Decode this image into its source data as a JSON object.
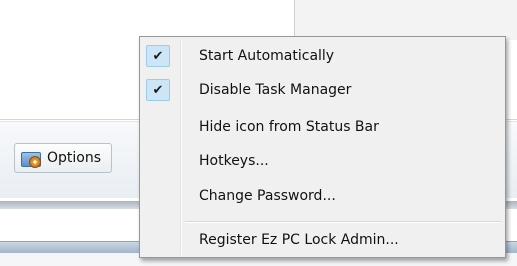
{
  "toolbar": {
    "options_label": "Options"
  },
  "context_menu": {
    "items": [
      {
        "label": "Start Automatically",
        "checked": true
      },
      {
        "label": "Disable Task Manager",
        "checked": true
      },
      {
        "label": "Hide icon from Status Bar",
        "checked": false
      },
      {
        "label": "Hotkeys...",
        "checked": false
      },
      {
        "label": "Change Password...",
        "checked": false
      },
      {
        "label": "Register Ez PC Lock Admin...",
        "checked": false
      }
    ],
    "check_glyph": "✔"
  },
  "colors": {
    "menu_background": "#f0f0f0",
    "check_highlight": "#cde6f7",
    "menu_border": "#979797"
  }
}
